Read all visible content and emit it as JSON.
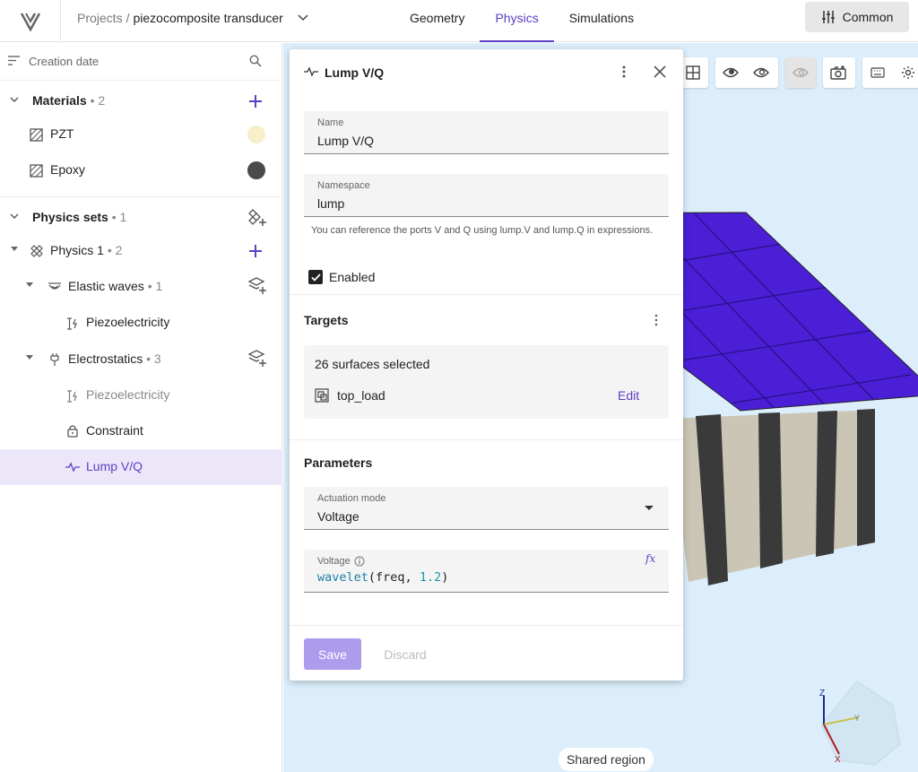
{
  "topbar": {
    "breadcrumb_root": "Projects",
    "breadcrumb_sep": "/",
    "project_name": "piezocomposite transducer",
    "tabs": [
      {
        "label": "Geometry"
      },
      {
        "label": "Physics",
        "active": true
      },
      {
        "label": "Simulations"
      }
    ],
    "common_label": "Common"
  },
  "sidebar": {
    "sort_label": "Creation date",
    "materials": {
      "title": "Materials",
      "count": "• 2",
      "items": [
        {
          "label": "PZT",
          "color": "#f6efc9"
        },
        {
          "label": "Epoxy",
          "color": "#4a4a4a"
        }
      ]
    },
    "physics_sets": {
      "title": "Physics sets",
      "count": "• 1"
    },
    "physics1": {
      "label": "Physics 1",
      "count": "• 2"
    },
    "elastic": {
      "label": "Elastic waves",
      "count": "• 1"
    },
    "elastic_children": [
      {
        "label": "Piezoelectricity"
      }
    ],
    "electrostatics": {
      "label": "Electrostatics",
      "count": "• 3"
    },
    "electro_children": [
      {
        "label": "Piezoelectricity"
      },
      {
        "label": "Constraint"
      },
      {
        "label": "Lump V/Q"
      }
    ]
  },
  "panel": {
    "title": "Lump V/Q",
    "name_label": "Name",
    "name_value": "Lump V/Q",
    "namespace_label": "Namespace",
    "namespace_value": "lump",
    "hint": "You can reference the ports V and Q using lump.V and lump.Q in expressions.",
    "enabled_label": "Enabled",
    "targets_title": "Targets",
    "targets_count": "26 surfaces selected",
    "target_name": "top_load",
    "edit_label": "Edit",
    "parameters_title": "Parameters",
    "actuation_label": "Actuation mode",
    "actuation_value": "Voltage",
    "voltage_label": "Voltage",
    "voltage_fn": "wavelet",
    "voltage_open": "(",
    "voltage_arg1": "freq, ",
    "voltage_num": "1.2",
    "voltage_close": ")",
    "fx_label": "fx",
    "save_label": "Save",
    "discard_label": "Discard"
  },
  "viewport": {
    "shared_region": "Shared region",
    "axis_z": "Z",
    "axis_y": "Y",
    "axis_x": "X",
    "colors": {
      "top_face": "#4a1fd6",
      "pzt_face": "#cbc5b5",
      "epoxy_face": "#3a3a3a",
      "background": "#dceefb"
    }
  },
  "colors": {
    "accent": "#5b3fc4",
    "selected_bg": "#ebe7f8"
  }
}
